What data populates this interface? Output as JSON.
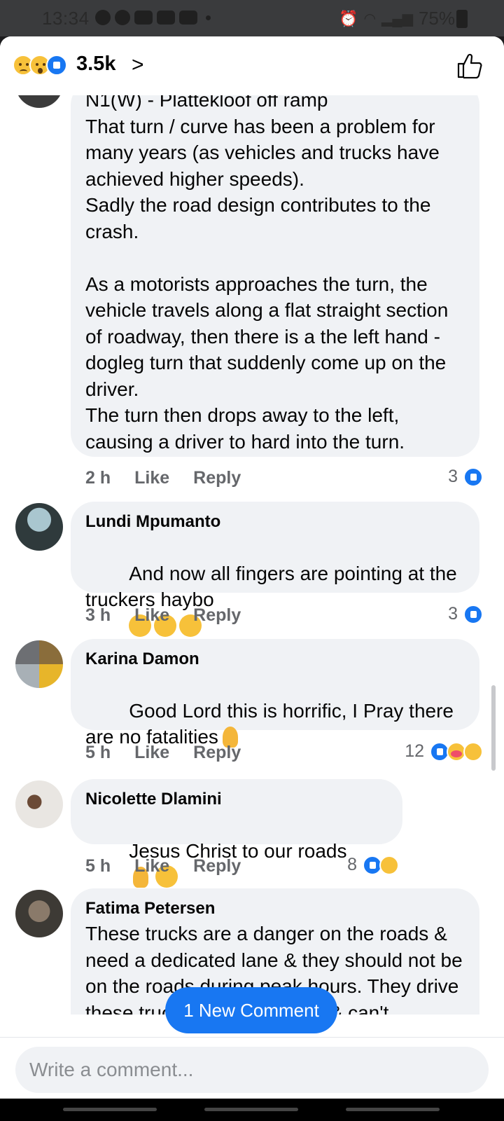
{
  "status_bar": {
    "time": "13:34",
    "battery": "75%"
  },
  "reactions": {
    "count": "3.5k",
    "icons": [
      "sad-icon",
      "wow-icon",
      "like-icon"
    ],
    "chevron": ">"
  },
  "comments": [
    {
      "author": "",
      "text": "N1(W) - Plattekloof off ramp\nThat turn / curve has been a problem for many years (as vehicles and trucks have achieved higher speeds).\nSadly the road design contributes to the crash.\n\nAs a motorists approaches the turn, the vehicle travels along a flat straight section of roadway, then there is a the left hand - dogleg turn that suddenly come up on the driver.\nThe turn then drops away to the left, causing a driver to hard into the turn.",
      "time": "2 h",
      "like_label": "Like",
      "reply_label": "Reply",
      "reaction_count": "3"
    },
    {
      "author": "Lundi Mpumanto",
      "text": "And now all fingers are pointing at the truckers haybo",
      "time": "3 h",
      "like_label": "Like",
      "reply_label": "Reply",
      "reaction_count": "3"
    },
    {
      "author": "Karina Damon",
      "text": "Good Lord this is horrific, I Pray there are no fatalities",
      "time": "5 h",
      "like_label": "Like",
      "reply_label": "Reply",
      "reaction_count": "12"
    },
    {
      "author": "Nicolette Dlamini",
      "text": "Jesus Christ to our roads",
      "time": "5 h",
      "like_label": "Like",
      "reply_label": "Reply",
      "reaction_count": "8"
    },
    {
      "author": "Fatima Petersen",
      "text": "These trucks are a danger on the roads & need a dedicated lane & they should not be on the roads during peak hours. They drive these trucks at high speeds & can't"
    }
  ],
  "new_comment_label": "1 New Comment",
  "composer": {
    "placeholder": "Write a comment..."
  }
}
